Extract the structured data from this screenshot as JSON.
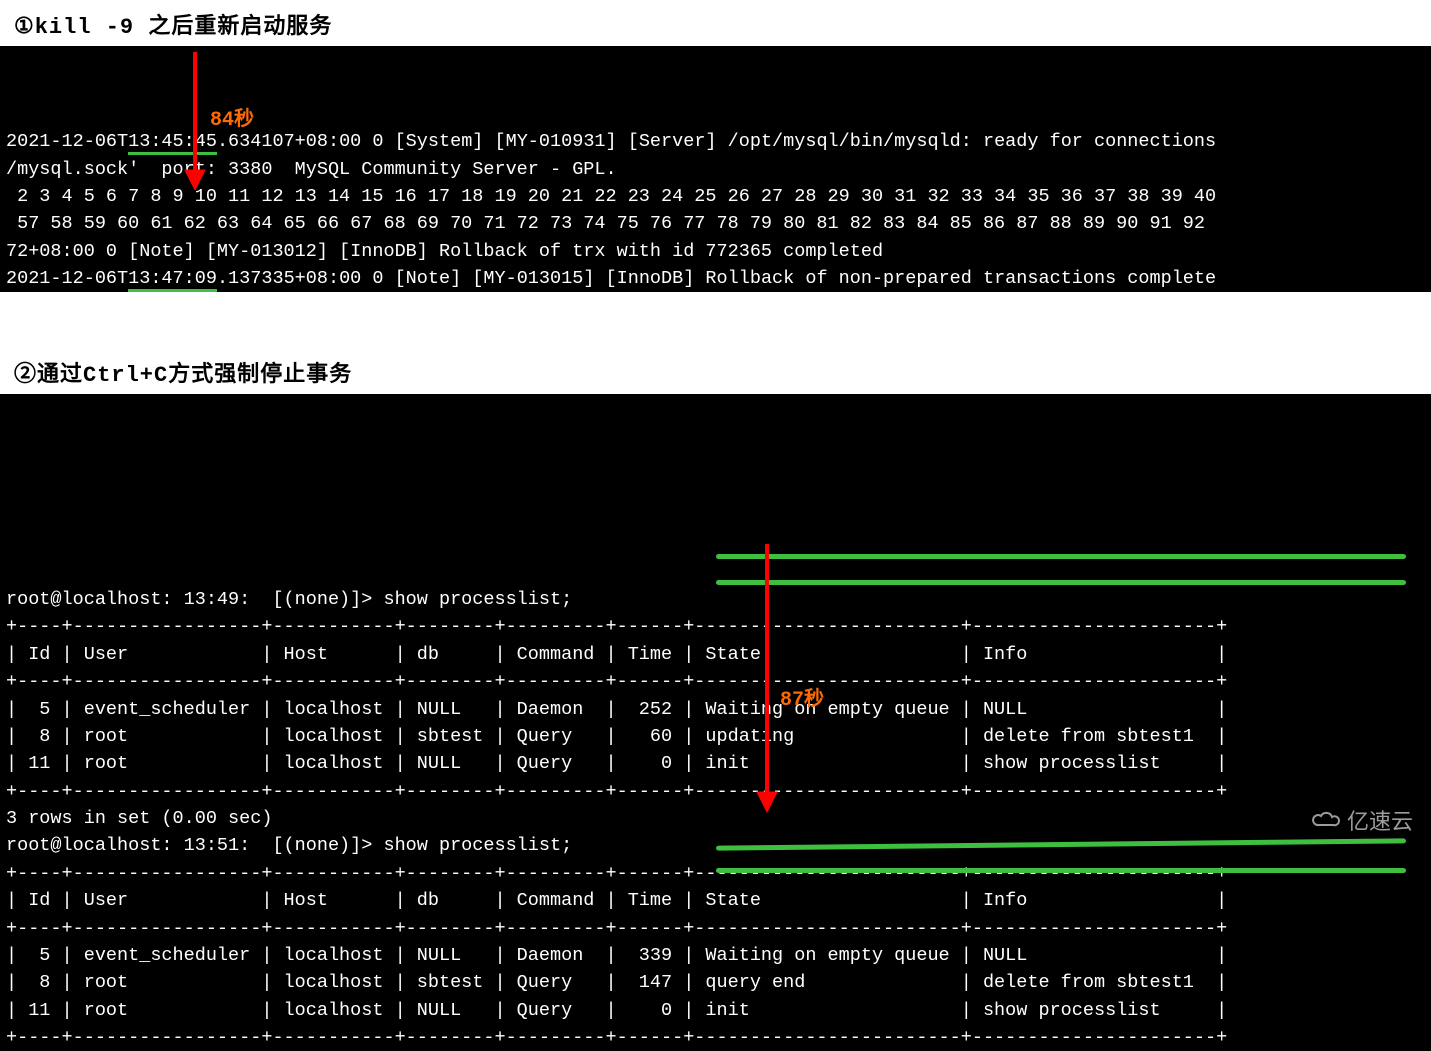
{
  "section1": {
    "heading": "①kill -9 之后重新启动服务",
    "annotation": "84秒",
    "log_lines": [
      {
        "plain_pre": "2021-12-06T",
        "underlined": "13:45:45",
        "plain_post": ".634107+08:00 0 [System] [MY-010931] [Server] /opt/mysql/bin/mysqld: ready for connections"
      },
      {
        "plain": "/mysql.sock'  port: 3380  MySQL Community Server - GPL."
      },
      {
        "plain": " 2 3 4 5 6 7 8 9 10 11 12 13 14 15 16 17 18 19 20 21 22 23 24 25 26 27 28 29 30 31 32 33 34 35 36 37 38 39 40"
      },
      {
        "plain": " 57 58 59 60 61 62 63 64 65 66 67 68 69 70 71 72 73 74 75 76 77 78 79 80 81 82 83 84 85 86 87 88 89 90 91 92"
      },
      {
        "plain": "72+08:00 0 [Note] [MY-013012] [InnoDB] Rollback of trx with id 772365 completed"
      },
      {
        "plain_pre": "2021-12-06T",
        "underlined": "13:47:09",
        "plain_post": ".137335+08:00 0 [Note] [MY-013015] [InnoDB] Rollback of non-prepared transactions complete"
      }
    ]
  },
  "section2": {
    "heading": "②通过Ctrl+C方式强制停止事务",
    "annotation": "87秒",
    "prompt1": "root@localhost: 13:49:  [(none)]> show processlist;",
    "headers": [
      "Id",
      "User",
      "Host",
      "db",
      "Command",
      "Time",
      "State",
      "Info"
    ],
    "rows1": [
      {
        "Id": "5",
        "User": "event_scheduler",
        "Host": "localhost",
        "db": "NULL",
        "Command": "Daemon",
        "Time": "252",
        "State": "Waiting on empty queue",
        "Info": "NULL"
      },
      {
        "Id": "8",
        "User": "root",
        "Host": "localhost",
        "db": "sbtest",
        "Command": "Query",
        "Time": "60",
        "State": "updating",
        "Info": "delete from sbtest1"
      },
      {
        "Id": "11",
        "User": "root",
        "Host": "localhost",
        "db": "NULL",
        "Command": "Query",
        "Time": "0",
        "State": "init",
        "Info": "show processlist"
      }
    ],
    "rows_footer1": "3 rows in set (0.00 sec)",
    "prompt2": "root@localhost: 13:51:  [(none)]> show processlist;",
    "rows2": [
      {
        "Id": "5",
        "User": "event_scheduler",
        "Host": "localhost",
        "db": "NULL",
        "Command": "Daemon",
        "Time": "339",
        "State": "Waiting on empty queue",
        "Info": "NULL"
      },
      {
        "Id": "8",
        "User": "root",
        "Host": "localhost",
        "db": "sbtest",
        "Command": "Query",
        "Time": "147",
        "State": "query end",
        "Info": "delete from sbtest1"
      },
      {
        "Id": "11",
        "User": "root",
        "Host": "localhost",
        "db": "NULL",
        "Command": "Query",
        "Time": "0",
        "State": "init",
        "Info": "show processlist"
      }
    ]
  },
  "watermark": "亿速云",
  "table_divider": "+----+-----------------+-----------+--------+---------+------+------------------------+----------------------+",
  "col_widths": {
    "Id": 2,
    "User": 15,
    "Host": 9,
    "db": 6,
    "Command": 7,
    "Time": 4,
    "State": 22,
    "Info": 20
  }
}
